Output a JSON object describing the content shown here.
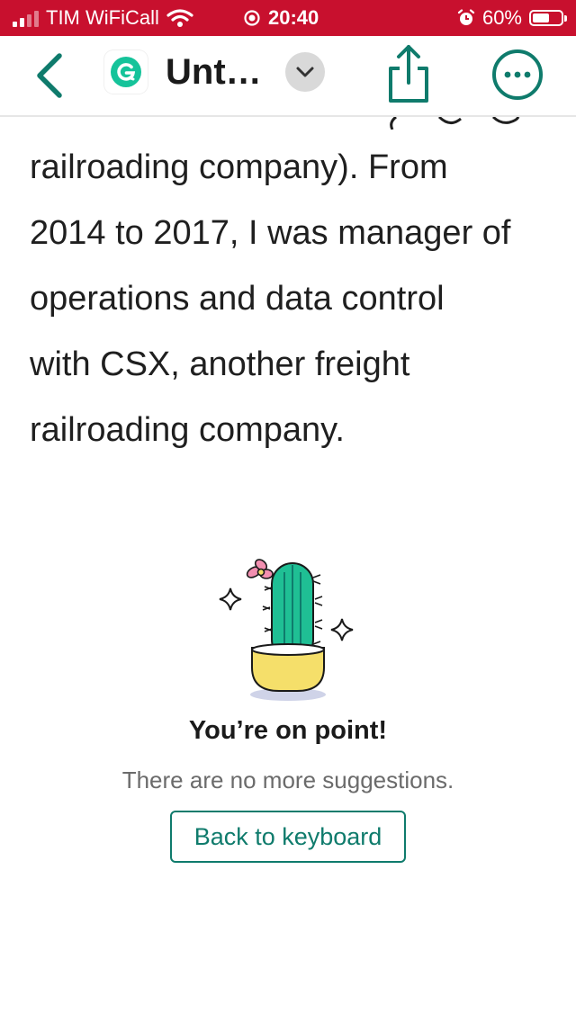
{
  "status_bar": {
    "carrier": "TIM WiFiCall",
    "time": "20:40",
    "battery": "60%",
    "battery_level": 0.6
  },
  "nav": {
    "doc_title": "Unt…",
    "back_icon": "chevron-left-icon",
    "dropdown_icon": "chevron-down-icon",
    "share_icon": "share-icon",
    "more_icon": "more-dots-icon"
  },
  "document": {
    "lines": [
      "railroading company). From",
      "2014 to 2017, I was manager of",
      "operations and data control",
      "with CSX, another freight",
      "railroading company."
    ]
  },
  "empty_state": {
    "title": "You’re on point!",
    "subtitle": "There are no more suggestions.",
    "button_label": "Back to keyboard"
  },
  "colors": {
    "status_bar": "#c8102e",
    "accent": "#0f7b6c",
    "cactus": "#1fbf94",
    "pot": "#f5df6a",
    "flower": "#f28fb0"
  }
}
